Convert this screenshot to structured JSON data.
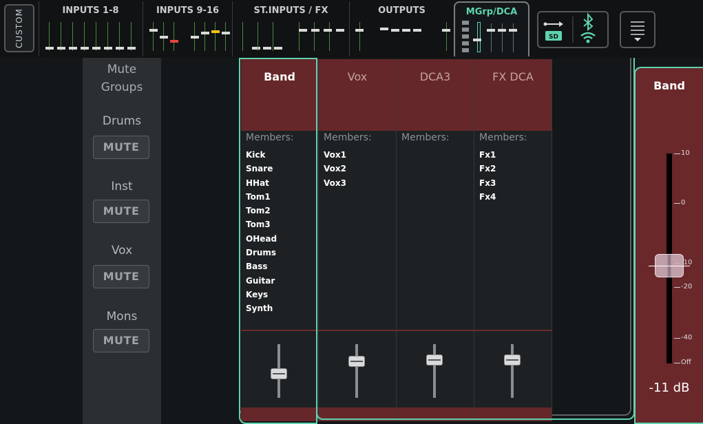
{
  "top_bar": {
    "custom_label": "CUSTOM",
    "tabs": [
      {
        "label": "INPUTS 1-8"
      },
      {
        "label": "INPUTS 9-16"
      },
      {
        "label": "ST.INPUTS / FX"
      },
      {
        "label": "OUTPUTS"
      },
      {
        "label": "MGrp/DCA"
      }
    ],
    "active_tab": "MGrp/DCA",
    "icons": [
      "usb-icon",
      "sdhc-icon",
      "bluetooth-icon",
      "wifi-icon",
      "menu-icon"
    ]
  },
  "mute_groups": {
    "title_line1": "Mute",
    "title_line2": "Groups",
    "groups": [
      {
        "name": "Drums",
        "button": "MUTE"
      },
      {
        "name": "Inst",
        "button": "MUTE"
      },
      {
        "name": "Vox",
        "button": "MUTE"
      },
      {
        "name": "Mons",
        "button": "MUTE"
      }
    ]
  },
  "dca": {
    "members_label": "Members:",
    "strips": [
      {
        "name": "Band",
        "selected": true,
        "members": [
          "Kick",
          "Snare",
          "HHat",
          "Tom1",
          "Tom2",
          "Tom3",
          "OHead",
          "Drums",
          "Bass",
          "Guitar",
          "Keys",
          "Synth"
        ]
      },
      {
        "name": "Vox",
        "selected": false,
        "members": [
          "Vox1",
          "Vox2",
          "Vox3"
        ]
      },
      {
        "name": "DCA3",
        "selected": false,
        "members": []
      },
      {
        "name": "FX DCA",
        "selected": false,
        "members": [
          "Fx1",
          "Fx2",
          "Fx3",
          "Fx4"
        ]
      }
    ]
  },
  "master": {
    "name": "Band",
    "scale": [
      "10",
      "0",
      "-10",
      "-20",
      "-40",
      "Off"
    ],
    "level": "-11 dB"
  },
  "colors": {
    "accent": "#5fd3b0",
    "dca_red": "#66272a",
    "panel": "#2b2f31"
  }
}
